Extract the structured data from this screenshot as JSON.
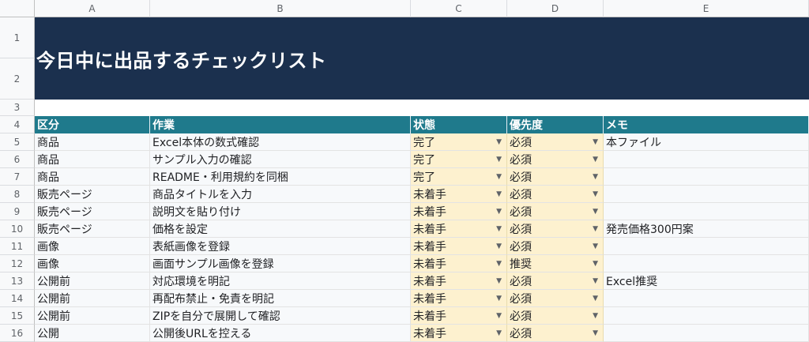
{
  "columns": [
    "A",
    "B",
    "C",
    "D",
    "E"
  ],
  "row_numbers": [
    "1",
    "2",
    "3",
    "4",
    "5",
    "6",
    "7",
    "8",
    "9",
    "10",
    "11",
    "12",
    "13",
    "14",
    "15",
    "16"
  ],
  "title": "今日中に出品するチェックリスト",
  "headers": [
    "区分",
    "作業",
    "状態",
    "優先度",
    "メモ"
  ],
  "rows": [
    {
      "category": "商品",
      "task": "Excel本体の数式確認",
      "status": "完了",
      "priority": "必須",
      "memo": "本ファイル"
    },
    {
      "category": "商品",
      "task": "サンプル入力の確認",
      "status": "完了",
      "priority": "必須",
      "memo": ""
    },
    {
      "category": "商品",
      "task": "README・利用規約を同梱",
      "status": "完了",
      "priority": "必須",
      "memo": ""
    },
    {
      "category": "販売ページ",
      "task": "商品タイトルを入力",
      "status": "未着手",
      "priority": "必須",
      "memo": ""
    },
    {
      "category": "販売ページ",
      "task": "説明文を貼り付け",
      "status": "未着手",
      "priority": "必須",
      "memo": ""
    },
    {
      "category": "販売ページ",
      "task": "価格を設定",
      "status": "未着手",
      "priority": "必須",
      "memo": "発売価格300円案"
    },
    {
      "category": "画像",
      "task": "表紙画像を登録",
      "status": "未着手",
      "priority": "必須",
      "memo": ""
    },
    {
      "category": "画像",
      "task": "画面サンプル画像を登録",
      "status": "未着手",
      "priority": "推奨",
      "memo": ""
    },
    {
      "category": "公開前",
      "task": "対応環境を明記",
      "status": "未着手",
      "priority": "必須",
      "memo": "Excel推奨"
    },
    {
      "category": "公開前",
      "task": "再配布禁止・免責を明記",
      "status": "未着手",
      "priority": "必須",
      "memo": ""
    },
    {
      "category": "公開前",
      "task": "ZIPを自分で展開して確認",
      "status": "未着手",
      "priority": "必須",
      "memo": ""
    },
    {
      "category": "公開",
      "task": "公開後URLを控える",
      "status": "未着手",
      "priority": "必須",
      "memo": ""
    }
  ],
  "colors": {
    "banner": "#1b304e",
    "header": "#1f7a8c",
    "dropdown_fill": "#fdf1cf"
  },
  "icons": {
    "dropdown": "dropdown-arrow-icon"
  }
}
